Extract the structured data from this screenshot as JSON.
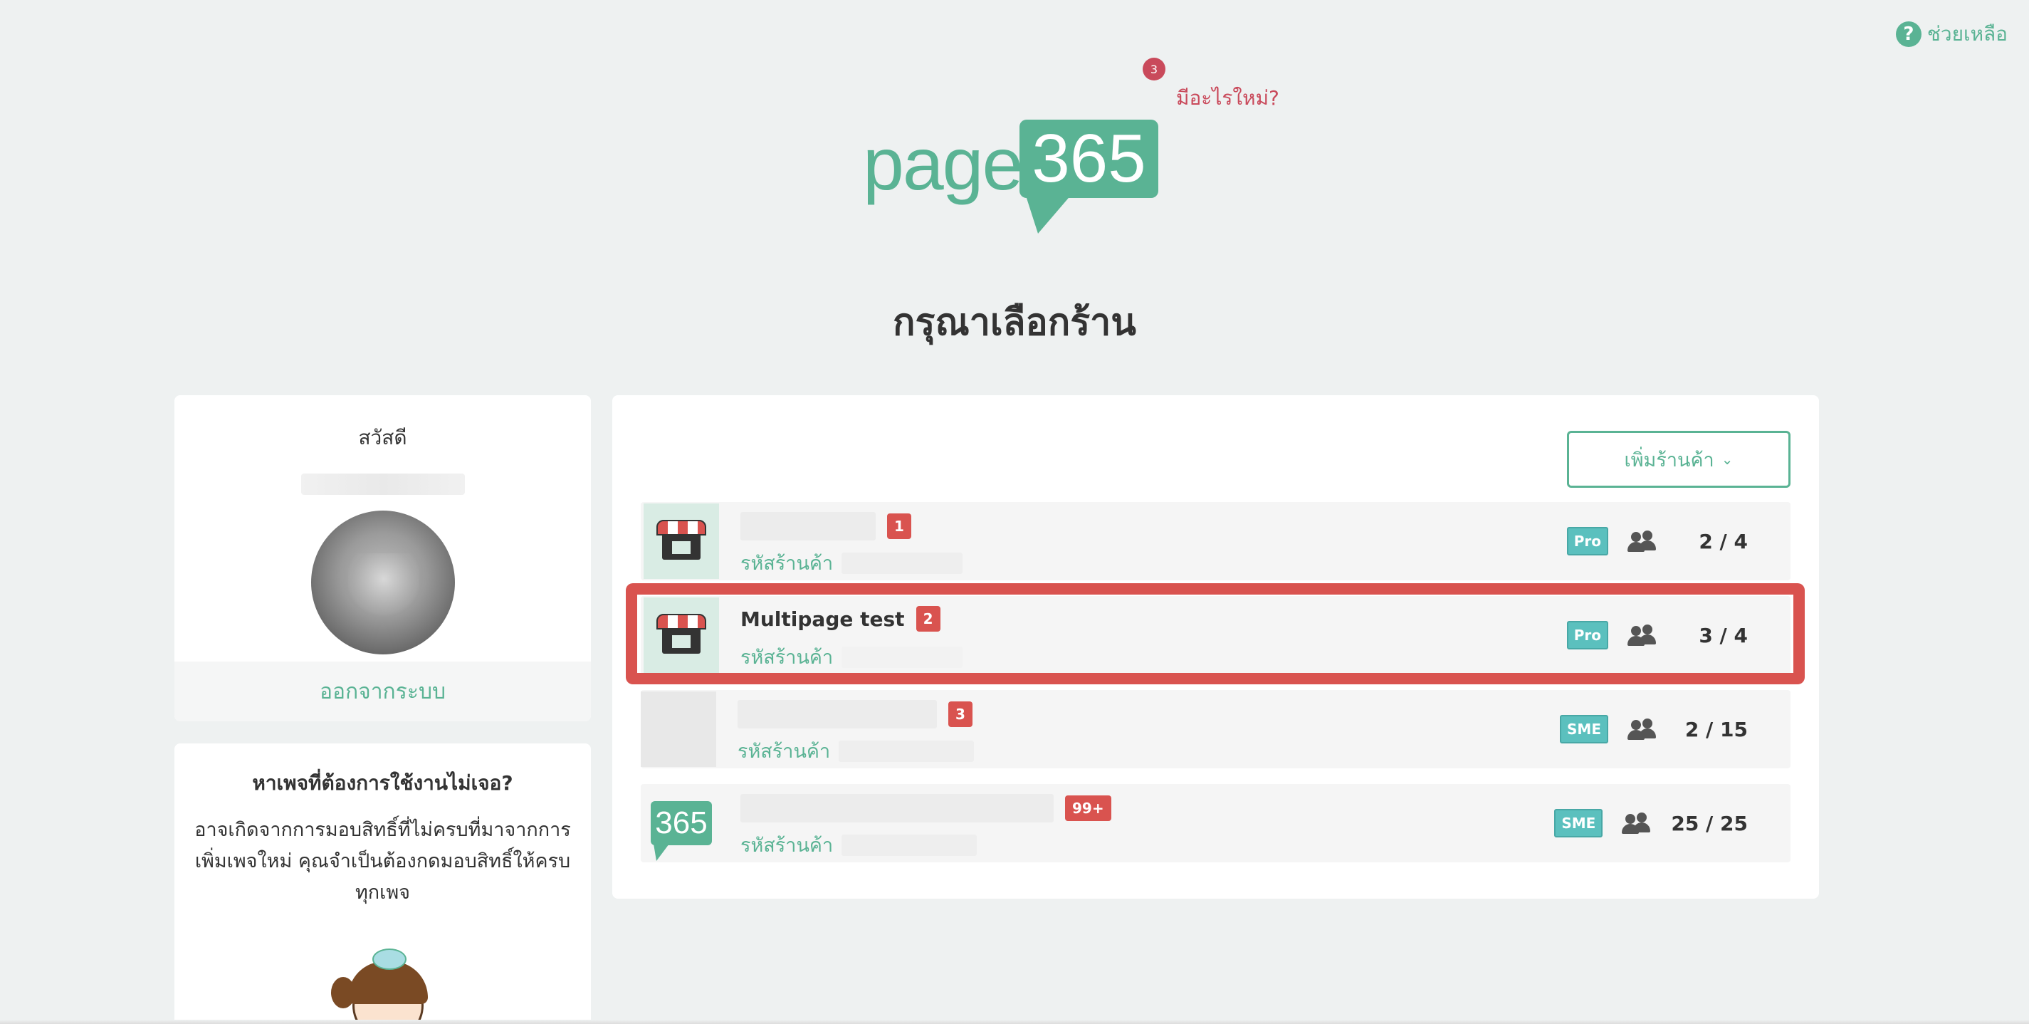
{
  "header": {
    "help_label": "ช่วยเหลือ",
    "help_icon": "question-circle-icon",
    "whats_new_label": "มีอะไรใหม่?",
    "whats_new_count": "3",
    "logo_text": "page",
    "logo_number": "365",
    "page_title": "กรุณาเลือกร้าน"
  },
  "profile": {
    "greeting": "สวัสดี",
    "logout_label": "ออกจากระบบ"
  },
  "help_card": {
    "title": "หาเพจที่ต้องการใช้งานไม่เจอ?",
    "text": "อาจเกิดจากการมอบสิทธิ์ที่ไม่ครบที่มาจากการเพิ่มเพจใหม่ คุณจำเป็นต้องกดมอบสิทธิ์ให้ครบทุกเพจ"
  },
  "stores_panel": {
    "add_store_label": "เพิ่มร้านค้า",
    "stores": [
      {
        "name": "",
        "badge": "1",
        "code_label": "รหัสร้านค้า",
        "plan": "Pro",
        "users": "2 / 4"
      },
      {
        "name": "Multipage test",
        "badge": "2",
        "code_label": "รหัสร้านค้า",
        "plan": "Pro",
        "users": "3 / 4"
      },
      {
        "name": "",
        "badge": "3",
        "code_label": "รหัสร้านค้า",
        "plan": "SME",
        "users": "2 / 15"
      },
      {
        "name": "",
        "badge": "99+",
        "code_label": "รหัสร้านค้า",
        "plan": "SME",
        "users": "25 / 25",
        "thumb_text": "365"
      }
    ]
  },
  "colors": {
    "brand_green": "#5ab394",
    "badge_red": "#d9534f",
    "plan_teal": "#5bc0be",
    "whats_new_red": "#c94a5b",
    "background": "#eef1f1"
  }
}
